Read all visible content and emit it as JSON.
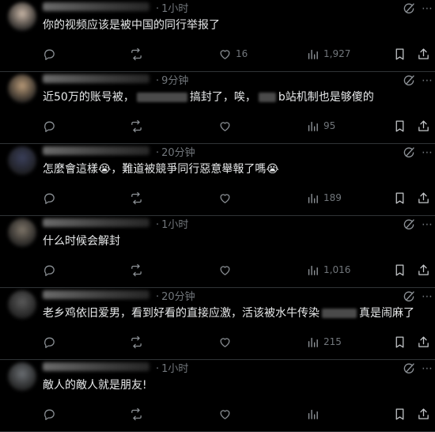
{
  "posts": [
    {
      "time": "1小时",
      "text_parts": [
        "你的视频应该是被中国的同行举报了"
      ],
      "reply_count": "",
      "repost_count": "",
      "like_count": "16",
      "view_count": "1,927",
      "avatar_color": "#c8b6a6"
    },
    {
      "time": "9分钟",
      "text_parts": [
        "近50万的账号被，",
        "搞封了，唉，",
        "b站机制也是够傻的"
      ],
      "reply_count": "",
      "repost_count": "",
      "like_count": "",
      "view_count": "95",
      "avatar_color": "#b89a78"
    },
    {
      "time": "20分钟",
      "text_parts": [
        "怎麼會這樣😭，難道被競爭同行惡意舉報了嗎😭"
      ],
      "reply_count": "",
      "repost_count": "",
      "like_count": "",
      "view_count": "189",
      "avatar_color": "#3a3f5a"
    },
    {
      "time": "1小时",
      "text_parts": [
        "什么时候会解封"
      ],
      "reply_count": "",
      "repost_count": "",
      "like_count": "",
      "view_count": "1,016",
      "avatar_color": "#7d7468"
    },
    {
      "time": "20分钟",
      "text_parts": [
        "老乡鸡依旧爱男，看到好看的直接应激，活该被水牛传染",
        "真是闹麻了"
      ],
      "reply_count": "",
      "repost_count": "",
      "like_count": "",
      "view_count": "215",
      "avatar_color": "#5a5a5a"
    },
    {
      "time": "1小时",
      "text_parts": [
        "敵人的敵人就是朋友!"
      ],
      "reply_count": "",
      "repost_count": "",
      "like_count": "",
      "view_count": "",
      "avatar_color": "#6a6e72"
    }
  ],
  "icons": {
    "reply": "reply-icon",
    "repost": "repost-icon",
    "like": "heart-icon",
    "views": "views-icon",
    "bookmark": "bookmark-icon",
    "share": "share-icon",
    "grok": "grok-icon",
    "more": "more-icon"
  },
  "colors": {
    "background": "#000000",
    "text": "#e7e9ea",
    "muted": "#71767b",
    "divider": "#2f3336"
  }
}
